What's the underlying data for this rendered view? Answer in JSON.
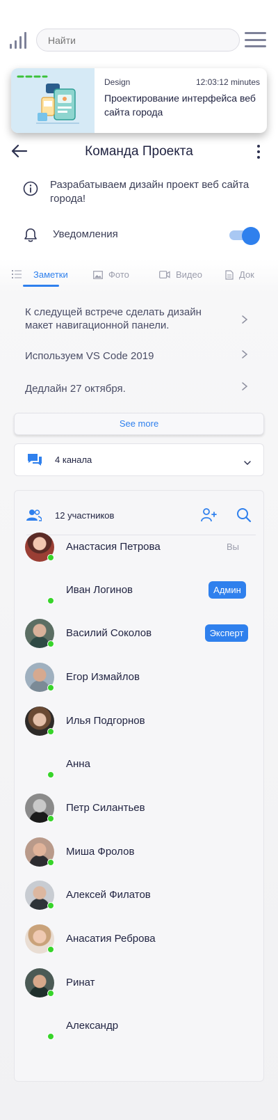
{
  "topbar": {
    "search_placeholder": "Найти",
    "signal_icon": "signal-bars-icon",
    "menu_icon": "hamburger-menu-icon"
  },
  "project_card": {
    "tag": "Design",
    "time": "12:03:12 minutes",
    "title": "Проектирование интерфейса веб сайта города",
    "image": "web-design-illustration"
  },
  "header": {
    "title": "Команда Проекта",
    "back_icon": "back-arrow-icon",
    "more_icon": "more-vertical-icon"
  },
  "info": {
    "text": "Разрабатываем дизайн проект веб сайта города!",
    "icon": "info-icon"
  },
  "notifications": {
    "label": "Уведомления",
    "enabled": true,
    "icon": "bell-icon"
  },
  "tabs": [
    {
      "label": "Заметки",
      "icon": "list-icon",
      "active": true
    },
    {
      "label": "Фото",
      "icon": "image-icon",
      "active": false
    },
    {
      "label": "Видео",
      "icon": "video-icon",
      "active": false
    },
    {
      "label": "Док",
      "icon": "document-icon",
      "active": false
    }
  ],
  "notes": [
    {
      "text": "К следущей встрече сделать дизайн макет навигационной панели."
    },
    {
      "text": "Используем VS Code 2019"
    },
    {
      "text": "Дедлайн 27 октября."
    }
  ],
  "see_more": "See more",
  "channels": {
    "label": "4 канала",
    "icon": "chat-bubbles-icon"
  },
  "members": {
    "label": "12 участников",
    "list": [
      {
        "name": "Анастасия Петрова",
        "role": "Вы",
        "avatar": true,
        "online": true
      },
      {
        "name": "Иван Логинов",
        "role": "Админ",
        "avatar": false,
        "online": true
      },
      {
        "name": "Василий Соколов",
        "role": "Эксперт",
        "avatar": true,
        "online": true
      },
      {
        "name": "Егор Измайлов",
        "role": "",
        "avatar": true,
        "online": true
      },
      {
        "name": "Илья Подгорнов",
        "role": "",
        "avatar": true,
        "online": true
      },
      {
        "name": "Анна",
        "role": "",
        "avatar": false,
        "online": true
      },
      {
        "name": "Петр Силантьев",
        "role": "",
        "avatar": true,
        "online": true
      },
      {
        "name": "Миша Фролов",
        "role": "",
        "avatar": true,
        "online": true
      },
      {
        "name": "Алексей Филатов",
        "role": "",
        "avatar": true,
        "online": true
      },
      {
        "name": "Анасатия Реброва",
        "role": "",
        "avatar": true,
        "online": true
      },
      {
        "name": "Ринат",
        "role": "",
        "avatar": true,
        "online": true
      },
      {
        "name": "Александр",
        "role": "",
        "avatar": false,
        "online": true
      }
    ]
  },
  "colors": {
    "accent": "#2f80ed",
    "online": "#37d42a",
    "text": "#1f2240"
  }
}
